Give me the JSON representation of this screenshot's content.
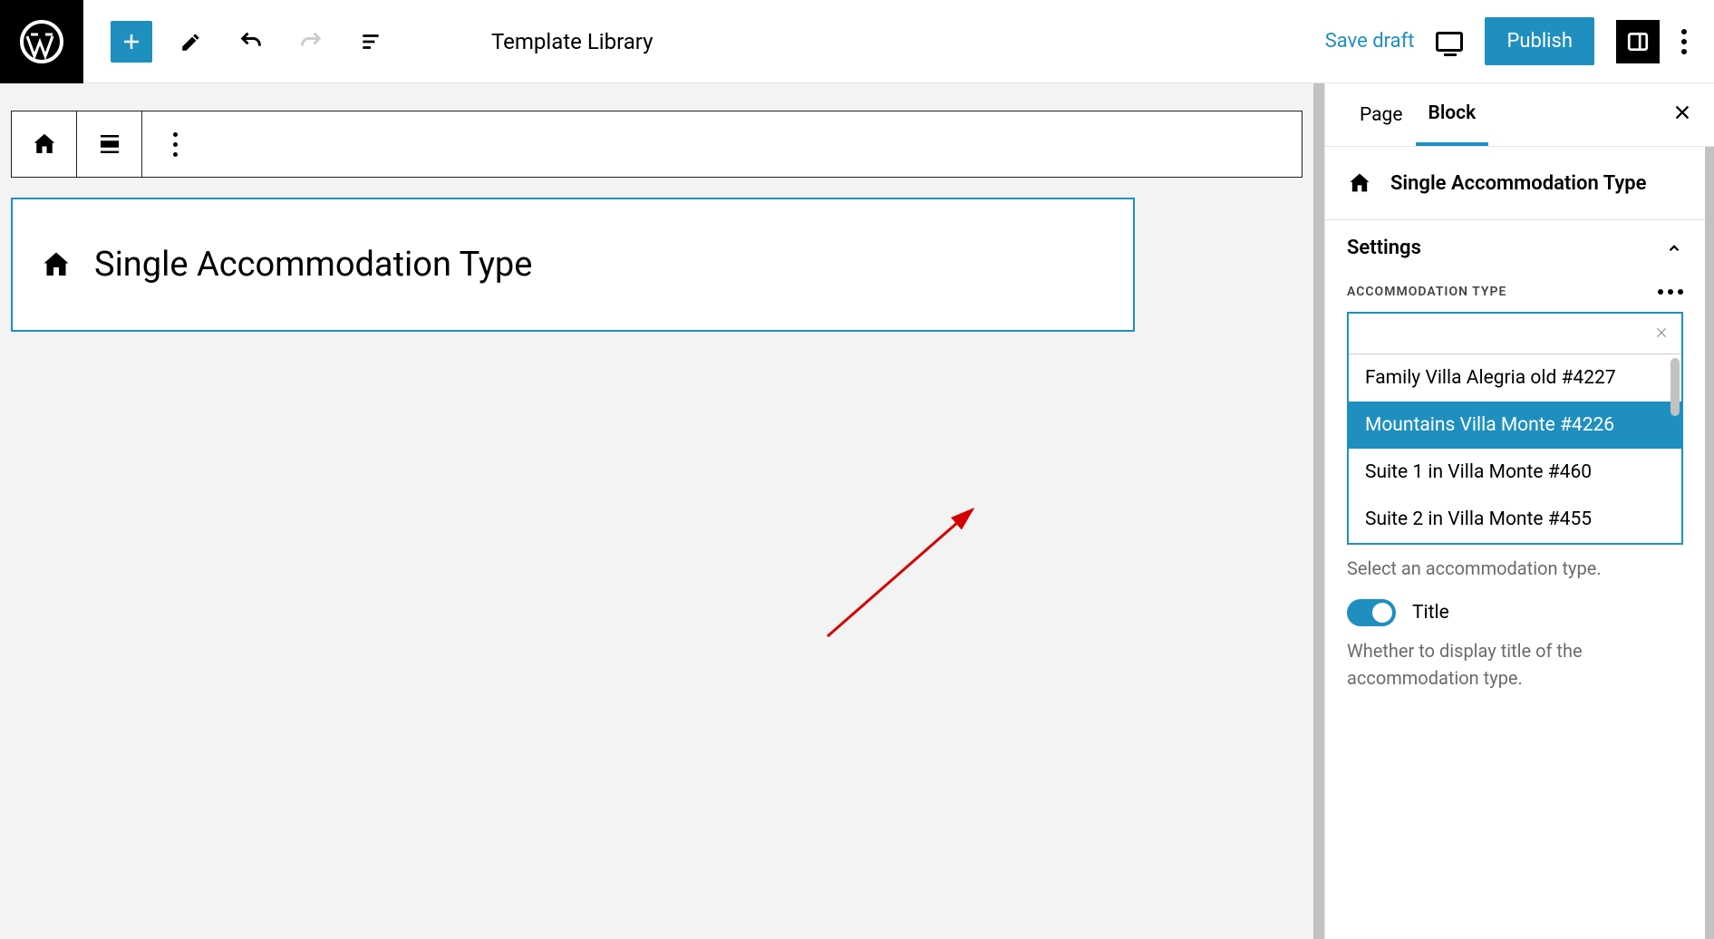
{
  "header": {
    "template_label": "Template Library",
    "save_draft": "Save draft",
    "publish": "Publish"
  },
  "block": {
    "name": "Single Accommodation Type"
  },
  "sidebar": {
    "tabs": {
      "page": "Page",
      "block": "Block"
    },
    "block_header": "Single Accommodation Type",
    "settings_label": "Settings",
    "field_label": "ACCOMMODATION TYPE",
    "combo_value": "",
    "options": [
      "Family Villa Alegria old #4227",
      "Mountains Villa Monte #4226",
      "Suite 1 in Villa Monte #460",
      "Suite 2 in Villa Monte #455"
    ],
    "selected_index": 1,
    "help_text": "Select an accommodation type.",
    "toggle_label": "Title",
    "toggle_desc": "Whether to display title of the accommodation type."
  }
}
